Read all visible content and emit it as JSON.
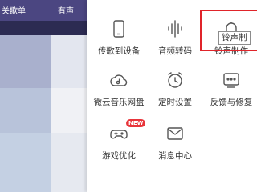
{
  "background_app": {
    "header_left": "关歌单",
    "header_right": "有声"
  },
  "menu": {
    "items": [
      {
        "label": "传歌到设备",
        "icon": "phone-icon"
      },
      {
        "label": "音频转码",
        "icon": "waveform-icon"
      },
      {
        "label": "铃声制作",
        "icon": "bell-icon"
      },
      {
        "label": "微云音乐网盘",
        "icon": "cloud-music-icon"
      },
      {
        "label": "定时设置",
        "icon": "alarm-clock-icon"
      },
      {
        "label": "反馈与修复",
        "icon": "feedback-icon"
      },
      {
        "label": "游戏优化",
        "icon": "gamepad-icon",
        "badge": "NEW"
      },
      {
        "label": "消息中心",
        "icon": "mail-icon"
      }
    ],
    "tooltip": "铃声制"
  },
  "colors": {
    "header_bg": "#4b4681",
    "highlight": "#e0242a",
    "badge": "#e8353b"
  }
}
